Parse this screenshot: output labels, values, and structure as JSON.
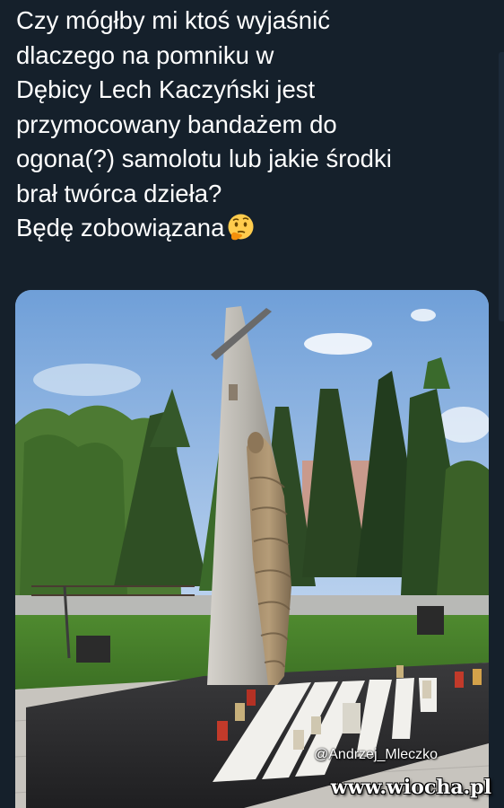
{
  "tweet": {
    "lines": [
      "Czy mógłby mi ktoś wyjaśnić",
      "dlaczego na pomniku w",
      "Dębicy Lech Kaczyński jest",
      "przymocowany bandażem do",
      "ogona(?) samolotu lub jakie środki",
      "brał twórca dzieła?",
      "Będę zobowiązana"
    ],
    "emoji": "thinking-face-icon"
  },
  "photo": {
    "credit": "@Andrzej_Mleczko"
  },
  "watermark": "www.wiocha.pl",
  "colors": {
    "background": "#15202b",
    "text": "#ffffff"
  }
}
